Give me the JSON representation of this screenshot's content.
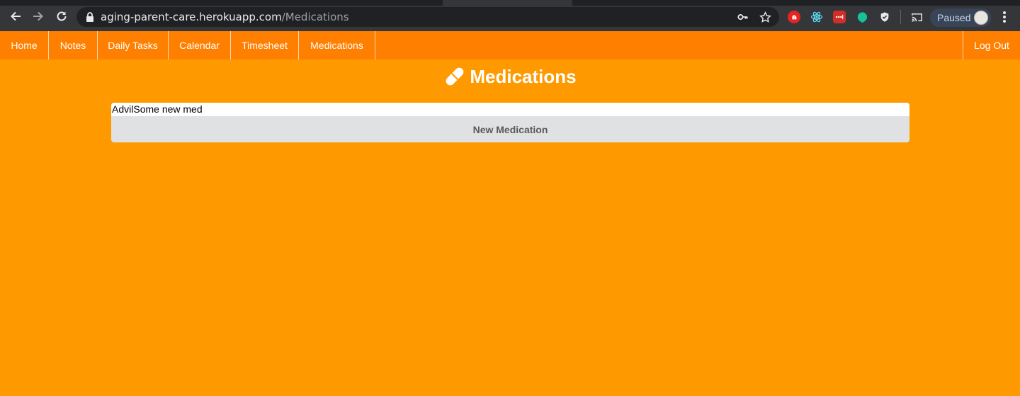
{
  "browser": {
    "url_host": "aging-parent-care.herokuapp.com",
    "url_path": "/Medications",
    "profile_status": "Paused",
    "icons": [
      "back-icon",
      "forward-icon",
      "reload-icon",
      "lock-icon",
      "key-icon",
      "star-icon",
      "cast-icon",
      "menu-icon"
    ],
    "extensions": [
      "adblock-extension",
      "react-devtools-extension",
      "lastpass-extension",
      "grammarly-extension",
      "shield-extension"
    ]
  },
  "nav": {
    "items": [
      {
        "label": "Home"
      },
      {
        "label": "Notes"
      },
      {
        "label": "Daily Tasks"
      },
      {
        "label": "Calendar"
      },
      {
        "label": "Timesheet"
      },
      {
        "label": "Medications"
      }
    ],
    "logout": "Log Out"
  },
  "page": {
    "title": "Medications",
    "icon": "pills-icon",
    "medications": [
      "Advil",
      "Some new med"
    ],
    "new_button": "New Medication"
  },
  "colors": {
    "page_bg": "#ff9900",
    "nav_bg": "#ff7f00",
    "button_bg": "#e0e1e2"
  }
}
